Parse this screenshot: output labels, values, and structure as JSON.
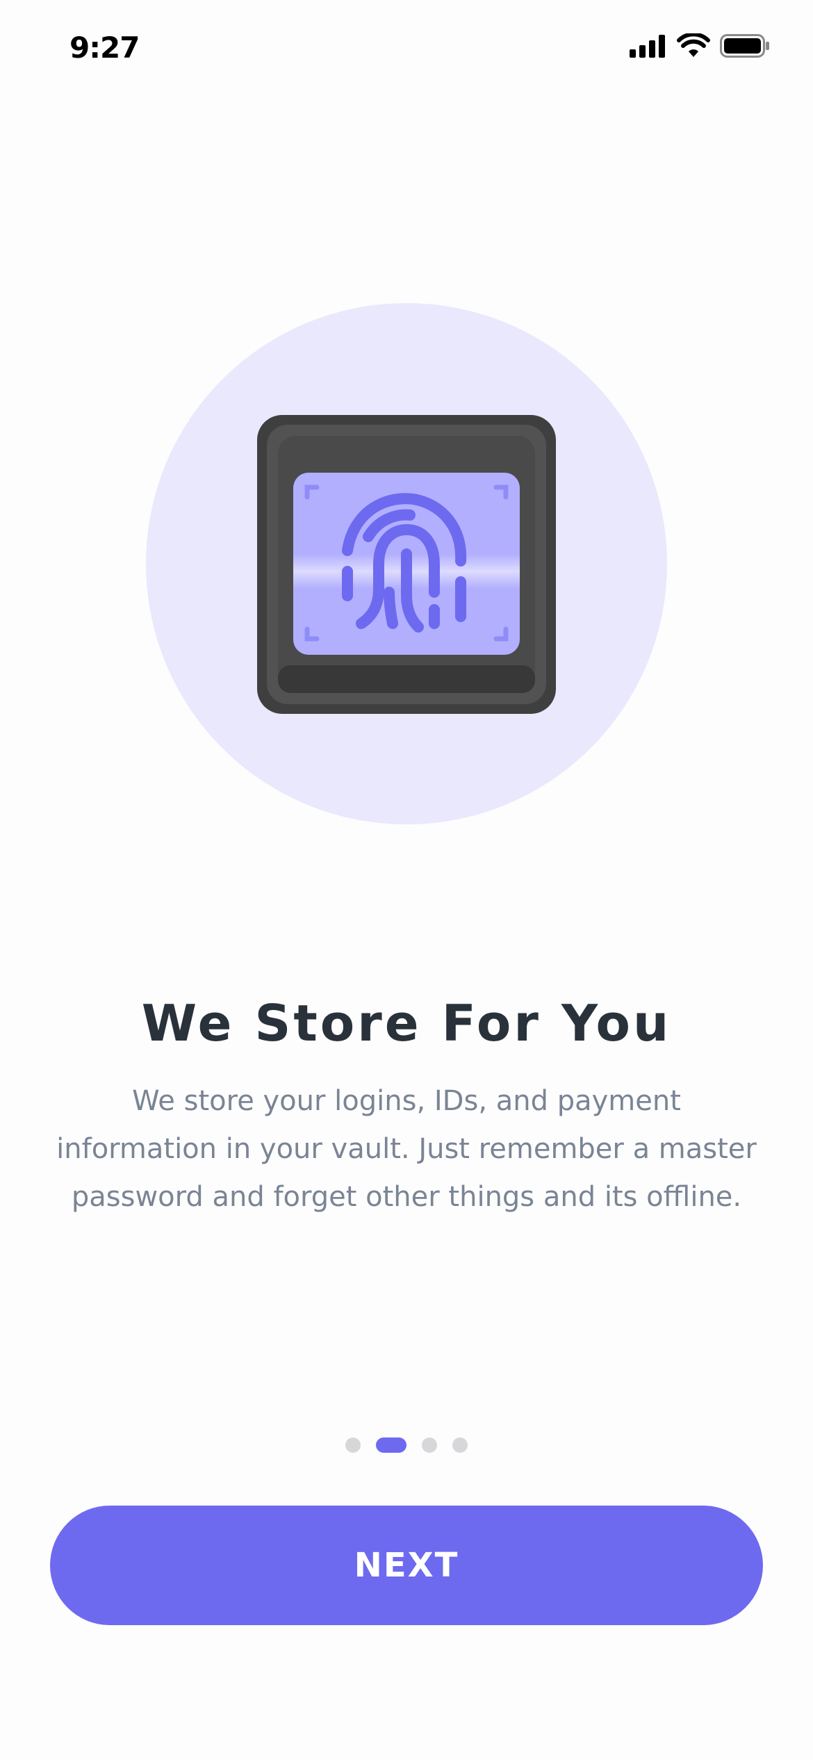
{
  "status_bar": {
    "time": "9:27",
    "icons": [
      "cellular-signal-icon",
      "wifi-icon",
      "battery-icon"
    ]
  },
  "hero": {
    "icon": "fingerprint-scanner-icon",
    "colors": {
      "circle": "#e9e8fd",
      "screen": "#b2affe",
      "fingerprint": "#6d6af0",
      "device": "#4a4a4a"
    }
  },
  "onboarding": {
    "title": "We Store For You",
    "description": "We store your logins, IDs, and payment information in your vault. Just remember a master password and forget other things and its offline.",
    "page_count": 4,
    "active_page": 2
  },
  "next_button": {
    "label": "NEXT",
    "color": "#6d6af0"
  }
}
